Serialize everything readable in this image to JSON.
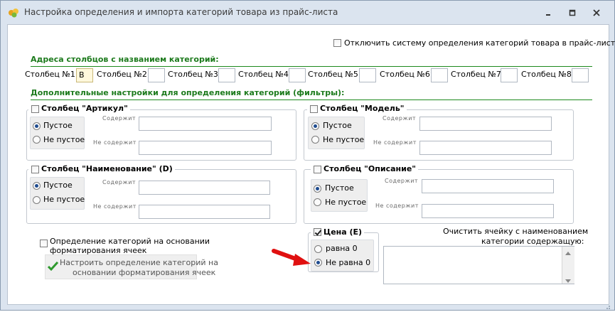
{
  "window": {
    "title": "Настройка определения и импорта категорий товара из прайс-листа"
  },
  "disable_system": {
    "label": "Отключить систему определения категорий товара в прайс-листе",
    "checked": false
  },
  "section_columns": {
    "title": "Адреса столбцов с названием категорий:"
  },
  "columns": [
    {
      "label": "Столбец №1:",
      "value": "B"
    },
    {
      "label": "Столбец №2:",
      "value": ""
    },
    {
      "label": "Столбец №3:",
      "value": ""
    },
    {
      "label": "Столбец №4:",
      "value": ""
    },
    {
      "label": "Столбец №5:",
      "value": ""
    },
    {
      "label": "Столбец №6:",
      "value": ""
    },
    {
      "label": "Столбец №7:",
      "value": ""
    },
    {
      "label": "Столбец №8:",
      "value": ""
    }
  ],
  "section_filters": {
    "title": "Дополнительные настройки для определения категорий (фильтры):"
  },
  "filters": {
    "article": {
      "title": "Столбец \"Артикул\"",
      "checked": false,
      "empty": "Пустое",
      "not_empty": "Не пустое",
      "selected": "empty",
      "contains": "Содержит",
      "not_contains": "Не содержит"
    },
    "model": {
      "title": "Столбец \"Модель\"",
      "checked": false,
      "empty": "Пустое",
      "not_empty": "Не пустое",
      "selected": "empty",
      "contains": "Содержит",
      "not_contains": "Не содержит"
    },
    "name": {
      "title": "Столбец \"Наименование\" (D)",
      "checked": false,
      "empty": "Пустое",
      "not_empty": "Не пустое",
      "selected": "empty",
      "contains": "Содержит",
      "not_contains": "Не содержит"
    },
    "description": {
      "title": "Столбец \"Описание\"",
      "checked": false,
      "empty": "Пустое",
      "not_empty": "Не пустое",
      "selected": "empty",
      "contains": "Содержит",
      "not_contains": "Не содержит"
    }
  },
  "price": {
    "title": "Цена (E)",
    "checked": true,
    "equals_zero": "равна 0",
    "not_equals_zero": "Не равна 0",
    "selected": "not_equals_zero"
  },
  "formatting": {
    "checkbox_label_1": "Определение категорий на основании",
    "checkbox_label_2": "форматирования ячеек",
    "checked": false,
    "button_line_1": "Настроить определение категорий на",
    "button_line_2": "основании форматирования ячеек"
  },
  "clear_cell": {
    "label_1": "Очистить ячейку с наименованием",
    "label_2": "категории содержащую:",
    "value": ""
  },
  "colors": {
    "section_green": "#1c7a1c",
    "annotation_arrow": "#e01010"
  }
}
